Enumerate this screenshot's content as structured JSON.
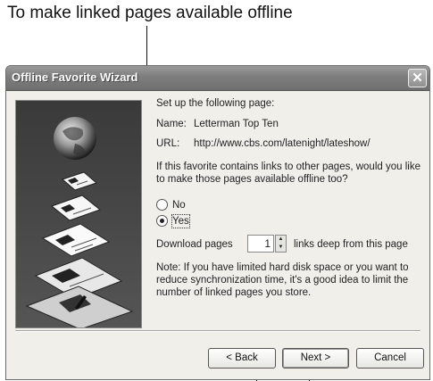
{
  "caption": "To make linked pages available offline",
  "window": {
    "title": "Offline Favorite Wizard",
    "close_symbol": "✕"
  },
  "content": {
    "setup_text": "Set up the following page:",
    "name_label": "Name:",
    "name_value": "Letterman Top Ten",
    "url_label": "URL:",
    "url_value": "http://www.cbs.com/latenight/lateshow/",
    "question": "If this favorite contains links to other pages, would you like to make those pages available offline too?",
    "options": [
      {
        "label": "No",
        "selected": false
      },
      {
        "label": "Yes",
        "selected": true
      }
    ],
    "download_label": "Download pages",
    "pages_value": "1",
    "links_deep_label": "links deep from this page",
    "note": "Note: If you have limited hard disk space or you want to reduce synchronization time, it's a good idea to limit the number of linked pages you store."
  },
  "buttons": {
    "back": "< Back",
    "next": "Next >",
    "cancel": "Cancel"
  },
  "icons": [
    "globe-icon",
    "web-page-icon",
    "folder-icon",
    "disk-icon",
    "close-icon",
    "spin-up-icon",
    "spin-down-icon"
  ]
}
